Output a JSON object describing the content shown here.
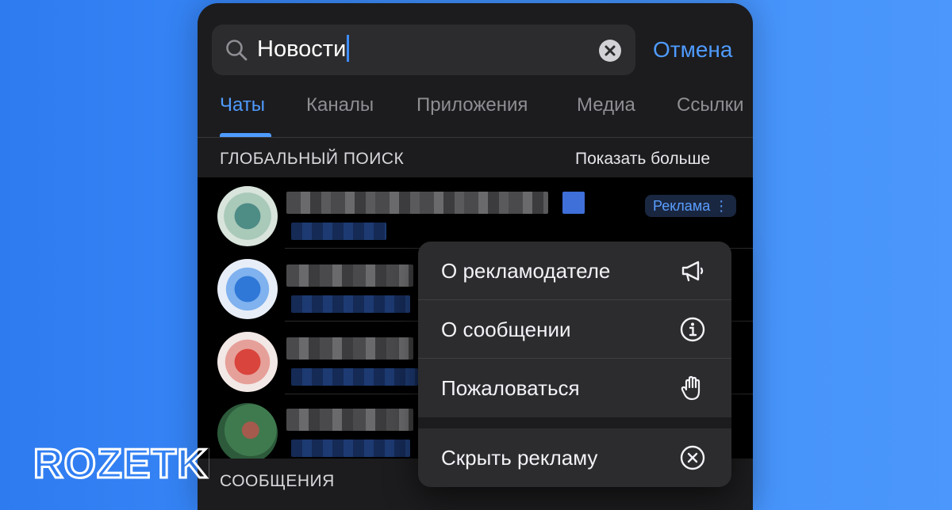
{
  "search": {
    "query": "Новости",
    "cancel_label": "Отмена"
  },
  "tabs": [
    {
      "label": "Чаты",
      "active": true
    },
    {
      "label": "Каналы",
      "active": false
    },
    {
      "label": "Приложения",
      "active": false
    },
    {
      "label": "Медиа",
      "active": false
    },
    {
      "label": "Ссылки",
      "active": false
    }
  ],
  "global_search": {
    "title": "ГЛОБАЛЬНЫЙ ПОИСК",
    "show_more": "Показать больше",
    "ad_badge": "Реклама ⋮"
  },
  "messages_section": {
    "title": "СООБЩЕНИЯ"
  },
  "context_menu": {
    "items": [
      {
        "label": "О рекламодателе",
        "icon": "megaphone-icon"
      },
      {
        "label": "О сообщении",
        "icon": "info-icon"
      },
      {
        "label": "Пожаловаться",
        "icon": "hand-icon"
      },
      {
        "label": "Скрыть рекламу",
        "icon": "close-circle-icon"
      }
    ]
  },
  "brand": {
    "logo_text": "ROZETKED"
  },
  "colors": {
    "accent": "#4f9bff",
    "background_gradient": "#3d8dfa",
    "panel": "#1c1c1e"
  }
}
